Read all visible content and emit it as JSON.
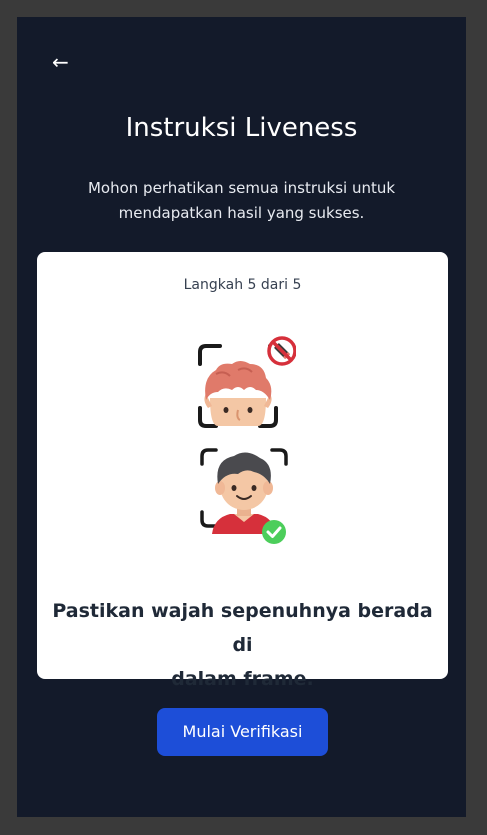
{
  "header": {
    "back_icon": "←",
    "title": "Instruksi Liveness",
    "subtitle_line1": "Mohon perhatikan semua instruksi untuk",
    "subtitle_line2": "mendapatkan hasil yang sukses."
  },
  "card": {
    "step_label": "Langkah 5  dari 5",
    "illustrations": [
      {
        "icon": "face-partially-out-of-frame-icon",
        "status": "wrong",
        "status_icon": "prohibited-icon"
      },
      {
        "icon": "face-fully-in-frame-icon",
        "status": "correct",
        "status_icon": "check-icon"
      }
    ],
    "instruction_line1": "Pastikan wajah sepenuhnya berada di",
    "instruction_line2": "dalam frame."
  },
  "actions": {
    "start_label": "Mulai Verifikasi"
  },
  "colors": {
    "background": "#131a2a",
    "card": "#ffffff",
    "primary_button": "#1d4ed8",
    "wrong": "#d6303b",
    "correct": "#4cce5b"
  }
}
